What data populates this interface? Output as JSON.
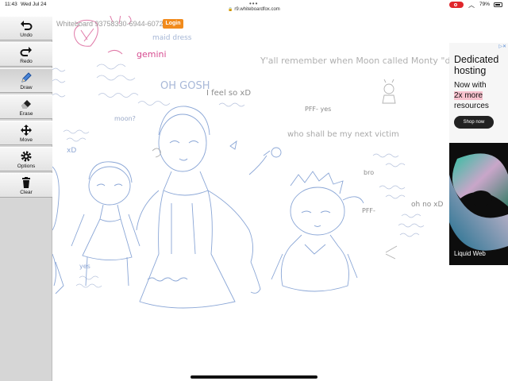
{
  "status": {
    "time": "11:43",
    "date": "Wed Jul 24",
    "battery_pct": "79%",
    "battery_level": 0.79
  },
  "browser": {
    "url": "r9.whiteboardfox.com"
  },
  "board": {
    "title": "Whiteboard 93758330-6944-6072",
    "login_label": "Login"
  },
  "toolbar": {
    "tools": [
      {
        "id": "undo",
        "label": "Undo",
        "icon": "undo-icon"
      },
      {
        "id": "redo",
        "label": "Redo",
        "icon": "redo-icon"
      },
      {
        "id": "draw",
        "label": "Draw",
        "icon": "pen-icon",
        "active": true
      },
      {
        "id": "erase",
        "label": "Erase",
        "icon": "eraser-icon"
      },
      {
        "id": "move",
        "label": "Move",
        "icon": "move-icon"
      },
      {
        "id": "options",
        "label": "Options",
        "icon": "gear-icon"
      },
      {
        "id": "clear",
        "label": "Clear",
        "icon": "trash-icon"
      }
    ]
  },
  "canvas": {
    "ink_colors": {
      "blue": "#8aa6d6",
      "pink": "#e07aa8",
      "gray": "#a8a8a8",
      "magenta": "#d64a8f"
    },
    "notes": [
      "maid dress",
      "gemini",
      "OH GOSH",
      "I feel so xD",
      "Y'all remember when Moon called Monty \"daddy\"",
      "who shall be my next victim",
      "PFF- yes",
      "bro",
      "PFF-",
      "oh no xD",
      "moon?",
      "xD",
      "yes"
    ]
  },
  "ad": {
    "title": "Dedicated hosting",
    "body_pre": "Now with",
    "highlight": "2x more",
    "body_post": "resources",
    "cta": "Shop now",
    "brand": "Liquid Web",
    "accent": "#f7c2ce"
  }
}
